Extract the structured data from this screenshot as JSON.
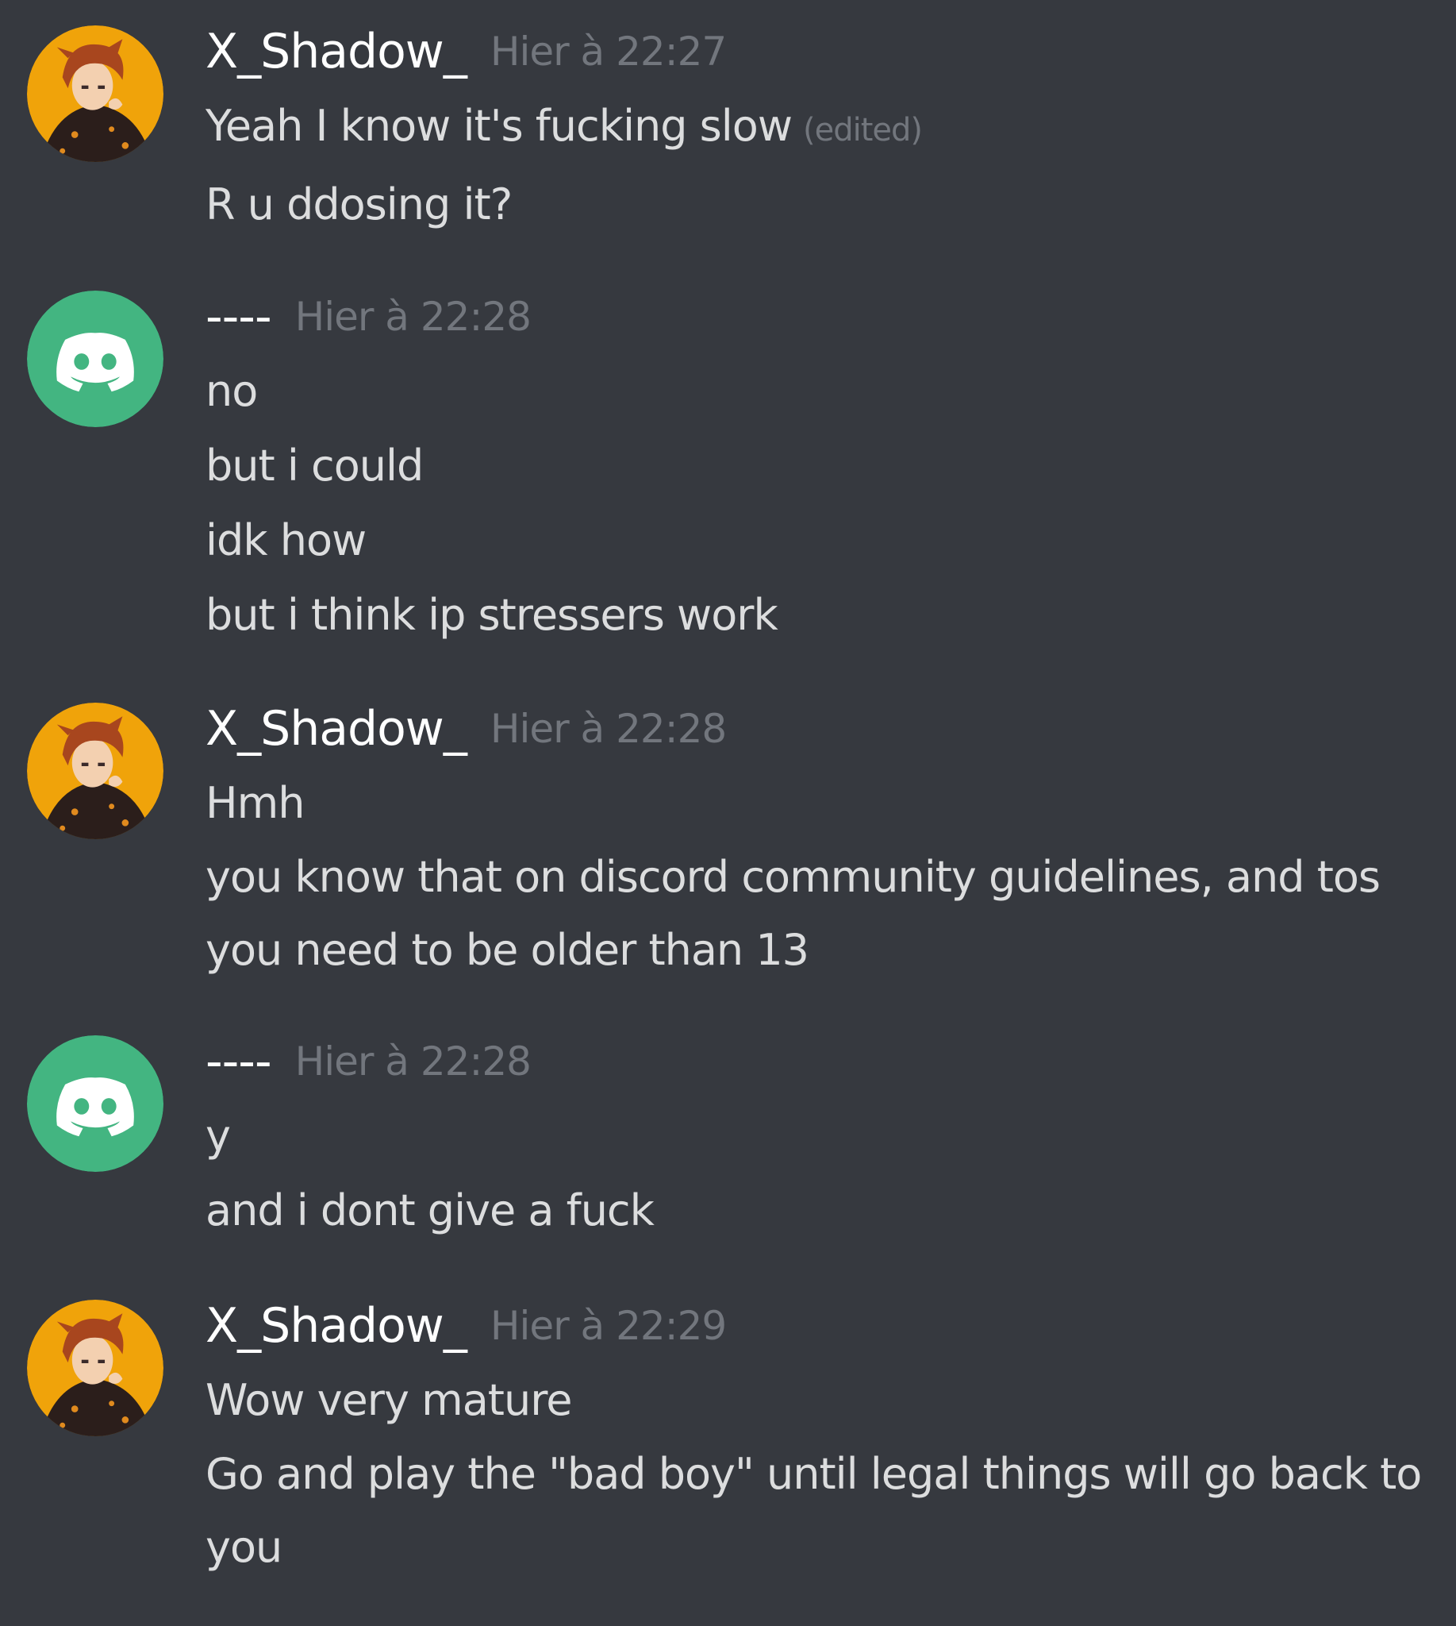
{
  "messages": [
    {
      "author": "X_Shadow_",
      "avatar_icon": "anime-character-avatar-icon",
      "timestamp": "Hier à 22:27",
      "lines": [
        "Yeah I know it's fucking slow",
        "R u ddosing it?"
      ],
      "edited_label": "(edited)"
    },
    {
      "author": "----",
      "avatar_icon": "discord-default-avatar-icon",
      "timestamp": "Hier à 22:28",
      "lines": [
        "no",
        "but i could",
        "idk how",
        "but i think ip stressers work"
      ]
    },
    {
      "author": "X_Shadow_",
      "avatar_icon": "anime-character-avatar-icon",
      "timestamp": "Hier à 22:28",
      "lines": [
        "Hmh",
        "you know that on discord community guidelines, and tos you need to be older than 13"
      ]
    },
    {
      "author": "----",
      "avatar_icon": "discord-default-avatar-icon",
      "timestamp": "Hier à 22:28",
      "lines": [
        "y",
        "and i dont give a fuck"
      ]
    },
    {
      "author": "X_Shadow_",
      "avatar_icon": "anime-character-avatar-icon",
      "timestamp": "Hier à 22:29",
      "lines": [
        "Wow very mature",
        "Go and play the \"bad boy\" until legal things will go back to you"
      ]
    }
  ],
  "colors": {
    "background": "#36393f",
    "username": "#ffffff",
    "timestamp": "#72767d",
    "message_text": "#dcddde",
    "discord_green": "#43b581",
    "avatar_orange": "#f0a30a"
  }
}
